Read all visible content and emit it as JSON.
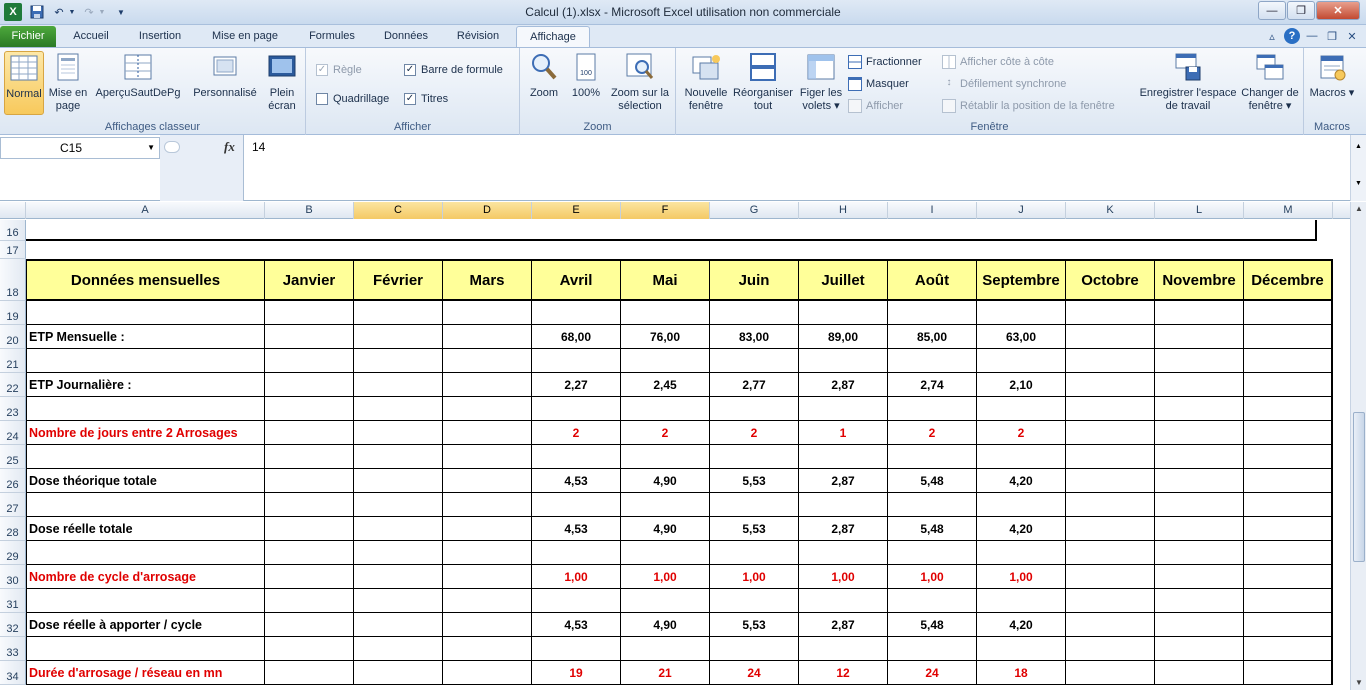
{
  "window": {
    "title": "Calcul (1).xlsx - Microsoft Excel utilisation non commerciale"
  },
  "tabs": [
    "Fichier",
    "Accueil",
    "Insertion",
    "Mise en page",
    "Formules",
    "Données",
    "Révision",
    "Affichage"
  ],
  "active_tab": "Affichage",
  "ribbon": {
    "affichages_classeur": {
      "label": "Affichages classeur",
      "normal": "Normal",
      "mise_en_page": "Mise en page",
      "apercu": "AperçuSautDePg",
      "personnalise": "Personnalisé",
      "plein_ecran": "Plein écran"
    },
    "afficher": {
      "label": "Afficher",
      "regle": "Règle",
      "barre_formule": "Barre de formule",
      "quadrillage": "Quadrillage",
      "titres": "Titres"
    },
    "zoom": {
      "label": "Zoom",
      "zoom": "Zoom",
      "cent": "100%",
      "zoom_selection": "Zoom sur la sélection"
    },
    "fenetre": {
      "label": "Fenêtre",
      "nouvelle": "Nouvelle fenêtre",
      "reorganiser": "Réorganiser tout",
      "figer": "Figer les volets ▾",
      "fractionner": "Fractionner",
      "masquer": "Masquer",
      "afficher": "Afficher",
      "cote_a_cote": "Afficher côte à côte",
      "defilement": "Défilement synchrone",
      "retablir": "Rétablir la position de la fenêtre",
      "enregistrer": "Enregistrer l'espace de travail",
      "changer": "Changer de fenêtre ▾"
    },
    "macros": {
      "label": "Macros",
      "macros": "Macros ▾"
    }
  },
  "formula_bar": {
    "namebox": "C15",
    "fx": "fx",
    "value": "14"
  },
  "columns": [
    "A",
    "B",
    "C",
    "D",
    "E",
    "F",
    "G",
    "H",
    "I",
    "J",
    "K",
    "L",
    "M"
  ],
  "header_row": [
    "Données mensuelles",
    "Janvier",
    "Février",
    "Mars",
    "Avril",
    "Mai",
    "Juin",
    "Juillet",
    "Août",
    "Septembre",
    "Octobre",
    "Novembre",
    "Décembre"
  ],
  "rows": [
    {
      "num": "16",
      "label": "",
      "vals": [],
      "red": false
    },
    {
      "num": "17",
      "label": "",
      "vals": [],
      "red": false
    },
    {
      "num": "18",
      "label": "",
      "vals": [],
      "red": false
    },
    {
      "num": "19",
      "label": "",
      "vals": [],
      "red": false
    },
    {
      "num": "20",
      "label": "ETP Mensuelle :",
      "vals": [
        "68,00",
        "76,00",
        "83,00",
        "89,00",
        "85,00",
        "63,00"
      ],
      "red": false
    },
    {
      "num": "21",
      "label": "",
      "vals": [],
      "red": false
    },
    {
      "num": "22",
      "label": "ETP Journalière :",
      "vals": [
        "2,27",
        "2,45",
        "2,77",
        "2,87",
        "2,74",
        "2,10"
      ],
      "red": false
    },
    {
      "num": "23",
      "label": "",
      "vals": [],
      "red": false
    },
    {
      "num": "24",
      "label": "Nombre de jours entre 2 Arrosages",
      "vals": [
        "2",
        "2",
        "2",
        "1",
        "2",
        "2"
      ],
      "red": true
    },
    {
      "num": "25",
      "label": "",
      "vals": [],
      "red": false
    },
    {
      "num": "26",
      "label": "Dose théorique totale",
      "vals": [
        "4,53",
        "4,90",
        "5,53",
        "2,87",
        "5,48",
        "4,20"
      ],
      "red": false
    },
    {
      "num": "27",
      "label": "",
      "vals": [],
      "red": false
    },
    {
      "num": "28",
      "label": "Dose réelle totale",
      "vals": [
        "4,53",
        "4,90",
        "5,53",
        "2,87",
        "5,48",
        "4,20"
      ],
      "red": false
    },
    {
      "num": "29",
      "label": "",
      "vals": [],
      "red": false
    },
    {
      "num": "30",
      "label": "Nombre de cycle d'arrosage",
      "vals": [
        "1,00",
        "1,00",
        "1,00",
        "1,00",
        "1,00",
        "1,00"
      ],
      "red": true
    },
    {
      "num": "31",
      "label": "",
      "vals": [],
      "red": false
    },
    {
      "num": "32",
      "label": "Dose réelle à apporter / cycle",
      "vals": [
        "4,53",
        "4,90",
        "5,53",
        "2,87",
        "5,48",
        "4,20"
      ],
      "red": false
    },
    {
      "num": "33",
      "label": "",
      "vals": [],
      "red": false
    },
    {
      "num": "34",
      "label": "Durée d'arrosage / réseau en mn",
      "vals": [
        "19",
        "21",
        "24",
        "12",
        "24",
        "18"
      ],
      "red": true
    }
  ],
  "colors": {
    "header_fill": "#ffff99",
    "red_text": "#e00000",
    "selected_col_header": "#f4c965"
  }
}
